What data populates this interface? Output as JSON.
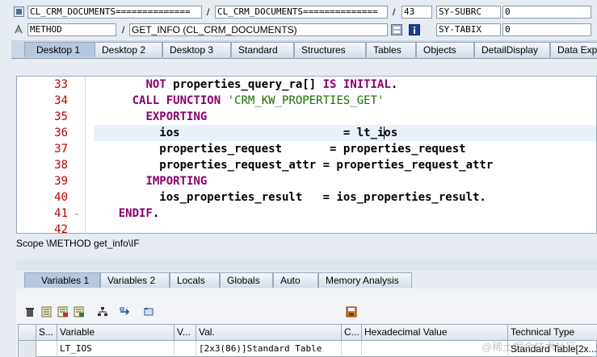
{
  "header": {
    "row1": {
      "field1": "CL_CRM_DOCUMENTS==============",
      "sep1": "/",
      "field2": "CL_CRM_DOCUMENTS==============",
      "sep2": "/",
      "line": "43",
      "var_name": "SY-SUBRC",
      "var_value": "0"
    },
    "row2": {
      "type": "METHOD",
      "sep": "/",
      "method": "GET_INFO (CL_CRM_DOCUMENTS)",
      "var_name": "SY-TABIX",
      "var_value": "0"
    }
  },
  "desktop_tabs": [
    "Desktop 1",
    "Desktop 2",
    "Desktop 3",
    "Standard",
    "Structures",
    "Tables",
    "Objects",
    "DetailDisplay",
    "Data Exp"
  ],
  "code": {
    "lines": [
      {
        "num": "33",
        "marker": "",
        "parts": [
          {
            "t": "        "
          },
          {
            "t": "NOT",
            "k": "kw"
          },
          {
            "t": " properties_query_ra[] "
          },
          {
            "t": "IS INITIAL",
            "k": "kw"
          },
          {
            "t": "."
          }
        ]
      },
      {
        "num": "34",
        "marker": "",
        "parts": [
          {
            "t": "      "
          },
          {
            "t": "CALL FUNCTION",
            "k": "kw"
          },
          {
            "t": " "
          },
          {
            "t": "'CRM_KW_PROPERTIES_GET'",
            "k": "str"
          }
        ]
      },
      {
        "num": "35",
        "marker": "",
        "parts": [
          {
            "t": "        "
          },
          {
            "t": "EXPORTING",
            "k": "kw"
          }
        ]
      },
      {
        "num": "36",
        "marker": "",
        "parts": [
          {
            "t": "          ios                        = lt_ios"
          }
        ]
      },
      {
        "num": "37",
        "marker": "",
        "parts": [
          {
            "t": "          properties_request       = properties_request"
          }
        ]
      },
      {
        "num": "38",
        "marker": "",
        "parts": [
          {
            "t": "          properties_request_attr = properties_request_attr"
          }
        ]
      },
      {
        "num": "39",
        "marker": "",
        "parts": [
          {
            "t": "        "
          },
          {
            "t": "IMPORTING",
            "k": "kw"
          }
        ]
      },
      {
        "num": "40",
        "marker": "",
        "parts": [
          {
            "t": "          ios_properties_result   = ios_properties_result."
          }
        ]
      },
      {
        "num": "41",
        "marker": "-",
        "parts": [
          {
            "t": "    "
          },
          {
            "t": "ENDIF",
            "k": "kw"
          },
          {
            "t": "."
          }
        ]
      },
      {
        "num": "42",
        "marker": "",
        "parts": [
          {
            "t": ""
          }
        ]
      }
    ]
  },
  "scope": "Scope \\METHOD get_info\\IF",
  "variable_tabs": [
    "Variables 1",
    "Variables 2",
    "Locals",
    "Globals",
    "Auto",
    "Memory Analysis"
  ],
  "toolbar_icons": [
    "delete-icon",
    "list-icon",
    "list-add-icon",
    "list-edit-icon",
    "hierarchy-icon",
    "navigate-icon",
    "folder-icon",
    "save-icon"
  ],
  "table": {
    "headers": [
      "S...",
      "Variable",
      "V...",
      "Val.",
      "C...",
      "Hexadecimal Value",
      "Technical Type"
    ],
    "rows": [
      [
        "",
        "LT_IOS",
        "",
        "[2x3(86)]Standard Table",
        "",
        "",
        "Standard Table[2x..."
      ]
    ]
  },
  "watermark": "@稀土掘金技术社区",
  "colors": {
    "keyword": "#8a006e",
    "string": "#1a6f00",
    "line_number": "#c00000"
  }
}
